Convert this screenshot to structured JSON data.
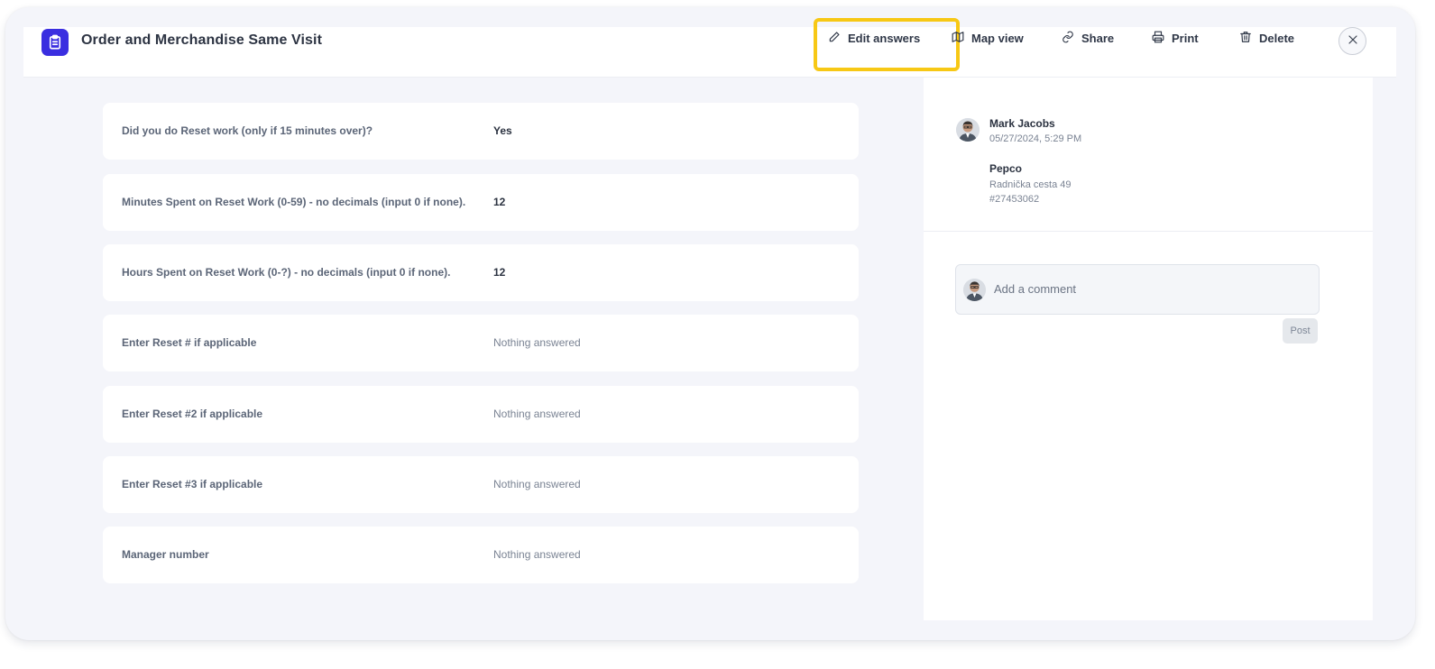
{
  "header": {
    "title": "Order and Merchandise Same Visit",
    "app_icon": "clipboard-icon",
    "actions": [
      {
        "label": "Edit answers",
        "icon": "pencil-icon"
      },
      {
        "label": "Map view",
        "icon": "map-icon"
      },
      {
        "label": "Share",
        "icon": "link-icon"
      },
      {
        "label": "Print",
        "icon": "printer-icon"
      },
      {
        "label": "Delete",
        "icon": "trash-icon"
      }
    ],
    "close_icon": "close-icon",
    "highlight_color": "#f7c815"
  },
  "answers": [
    {
      "question": "Did you do Reset work (only if 15 minutes over)?",
      "answer": "Yes"
    },
    {
      "question": "Minutes Spent on Reset Work (0-59) - no decimals (input 0 if none).",
      "answer": "12"
    },
    {
      "question": "Hours Spent on Reset Work (0-?) - no decimals (input 0 if none).",
      "answer": "12"
    },
    {
      "question": "Enter Reset # if applicable",
      "answer": "Nothing answered"
    },
    {
      "question": "Enter Reset #2 if applicable",
      "answer": "Nothing answered"
    },
    {
      "question": "Enter Reset #3 if applicable",
      "answer": "Nothing answered"
    },
    {
      "question": "Manager number",
      "answer": "Nothing answered"
    }
  ],
  "sidebar": {
    "author": {
      "name": "Mark Jacobs",
      "date": "05/27/2024, 5:29 PM"
    },
    "store": {
      "name": "Pepco",
      "address": "Radnička cesta 49",
      "id": "#27453062"
    },
    "comment": {
      "placeholder": "Add a comment",
      "post_label": "Post"
    }
  },
  "colors": {
    "accent": "#3a2ee0",
    "background": "#f4f5fa"
  }
}
